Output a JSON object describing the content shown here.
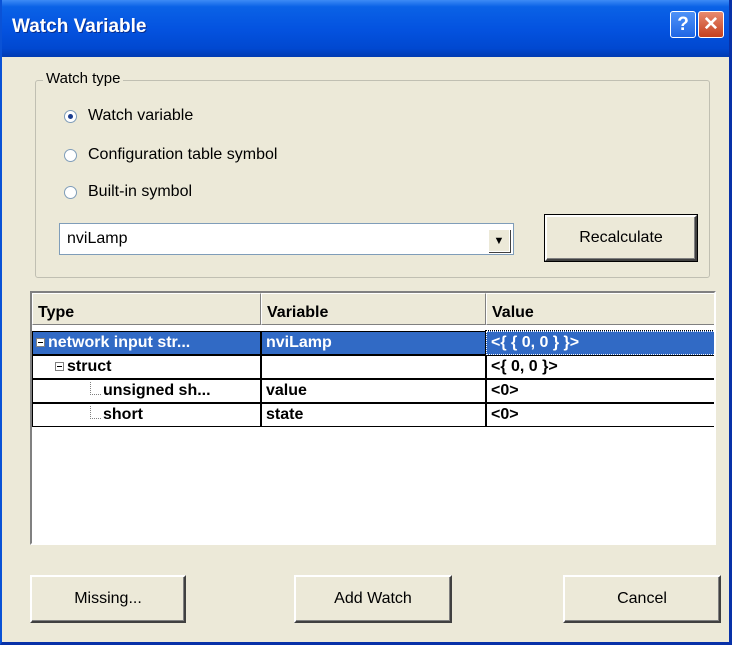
{
  "window": {
    "title": "Watch Variable"
  },
  "watch_type": {
    "legend": "Watch type",
    "options": [
      {
        "label": "Watch variable",
        "checked": true
      },
      {
        "label": "Configuration table symbol",
        "checked": false
      },
      {
        "label": "Built-in symbol",
        "checked": false
      }
    ],
    "combo_value": "nviLamp",
    "recalculate_label": "Recalculate"
  },
  "tree": {
    "columns": [
      "Type",
      "Variable",
      "Value"
    ],
    "rows": [
      {
        "type": "network input str...",
        "variable": "nviLamp",
        "value": "<{ { 0, 0 } }>",
        "selected": true
      },
      {
        "type": "struct",
        "variable": "",
        "value": "<{ 0, 0 }>"
      },
      {
        "type": "unsigned sh...",
        "variable": "value",
        "value": "<0>"
      },
      {
        "type": "short",
        "variable": "state",
        "value": "<0>"
      }
    ]
  },
  "buttons": {
    "missing": "Missing...",
    "add_watch": "Add Watch",
    "cancel": "Cancel"
  }
}
